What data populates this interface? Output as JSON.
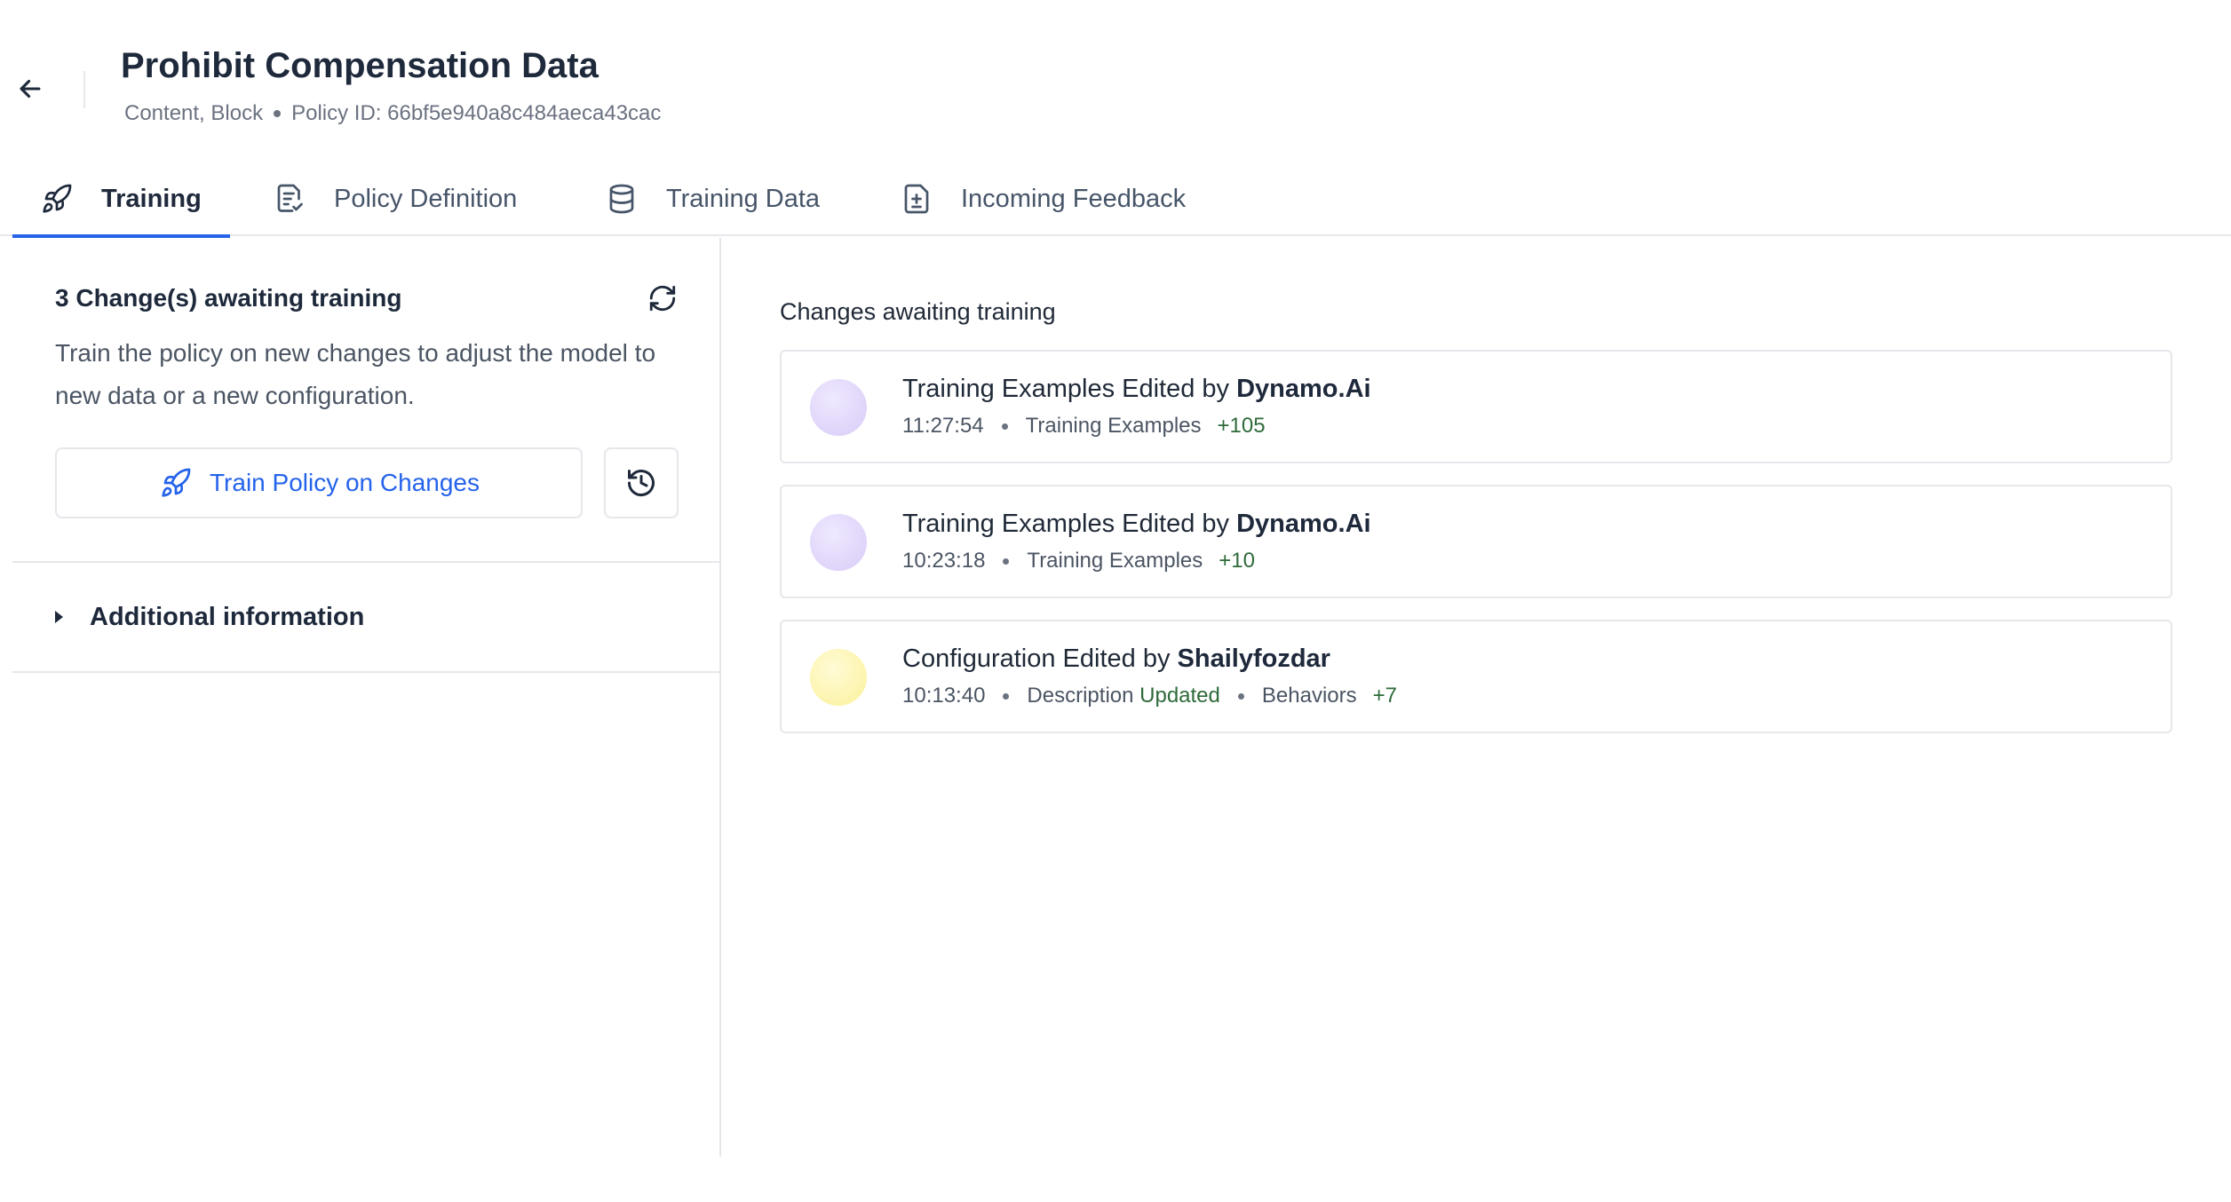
{
  "header": {
    "title": "Prohibit Compensation Data",
    "tags": "Content, Block",
    "policy_id_label": "Policy ID: 66bf5e940a8c484aeca43cac"
  },
  "tabs": [
    {
      "label": "Training",
      "icon": "rocket-icon",
      "active": true
    },
    {
      "label": "Policy Definition",
      "icon": "clipboard-check-icon",
      "active": false
    },
    {
      "label": "Training Data",
      "icon": "database-icon",
      "active": false
    },
    {
      "label": "Incoming Feedback",
      "icon": "file-diff-icon",
      "active": false
    }
  ],
  "left_panel": {
    "awaiting_title": "3 Change(s) awaiting training",
    "description": "Train the policy on new changes to adjust the model to new data or a new configuration.",
    "train_button_label": "Train Policy on Changes",
    "additional_info_label": "Additional information"
  },
  "right_panel": {
    "title": "Changes awaiting training",
    "changes": [
      {
        "prefix": "Training Examples Edited by ",
        "author": "Dynamo.Ai",
        "time": "11:27:54",
        "category": "Training Examples",
        "delta": "+105",
        "avatar_color": "#ddd0f8"
      },
      {
        "prefix": "Training Examples Edited by ",
        "author": "Dynamo.Ai",
        "time": "10:23:18",
        "category": "Training Examples",
        "delta": "+10",
        "avatar_color": "#ddd0f8"
      },
      {
        "prefix": "Configuration Edited by ",
        "author": "Shailyfozdar",
        "time": "10:13:40",
        "category": "Description",
        "status": "Updated",
        "category2": "Behaviors",
        "delta": "+7",
        "avatar_color": "#fbf19a"
      }
    ]
  },
  "colors": {
    "accent": "#2563eb",
    "positive": "#2f6b3a",
    "border": "#e5e7eb"
  }
}
